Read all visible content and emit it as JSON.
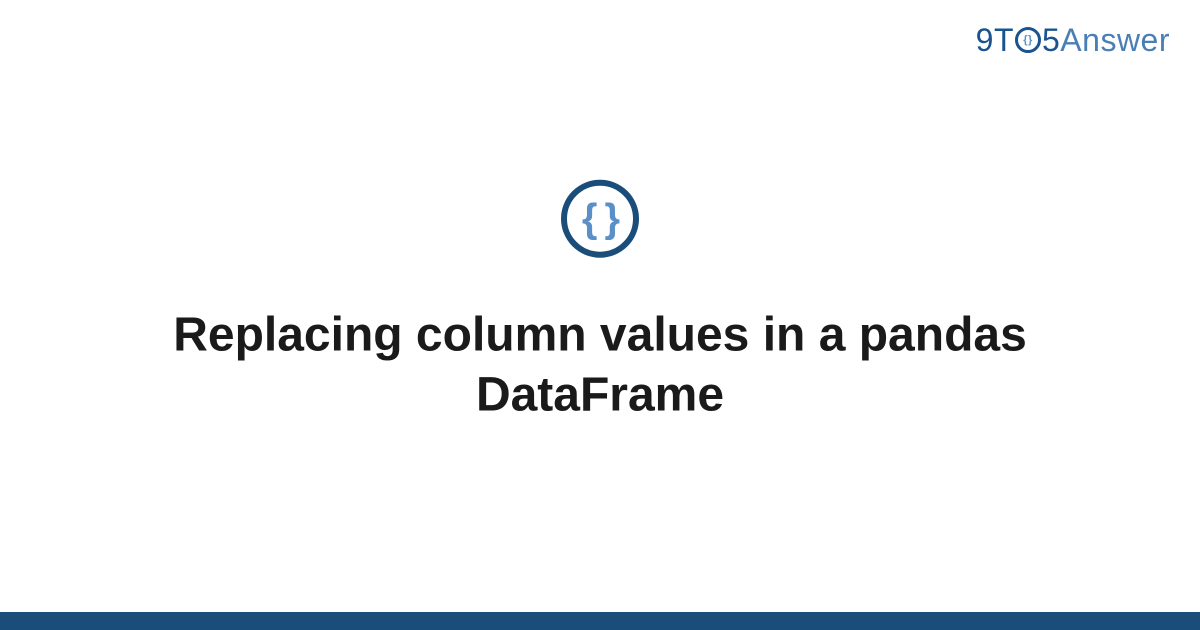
{
  "logo": {
    "part1": "9",
    "part2": "T",
    "part3": "5",
    "part4": "Answer"
  },
  "icon": {
    "name": "code-braces-icon",
    "glyph": "{ }"
  },
  "title": "Replacing column values in a pandas DataFrame",
  "colors": {
    "primary_dark": "#1a4d7a",
    "primary_light": "#5a8fc7",
    "text": "#1a1a1a"
  }
}
